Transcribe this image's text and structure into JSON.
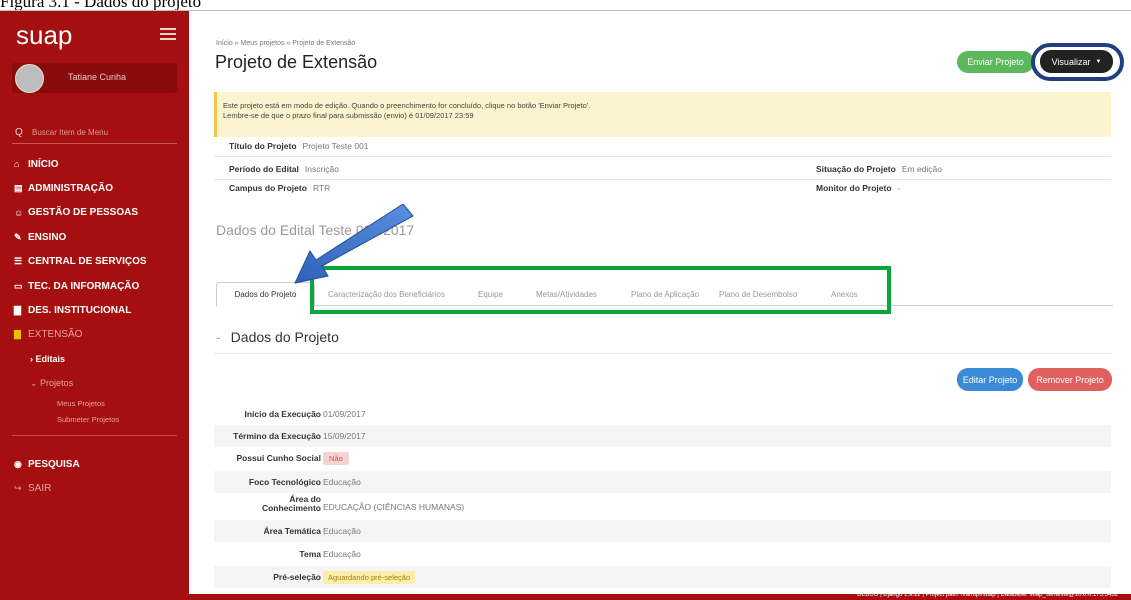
{
  "caption": "Figura 3.1 - Dados do projeto",
  "sidebar": {
    "brand": "suap",
    "user_name": "Tatiane Cunha",
    "search_placeholder": "Buscar Item de Menu",
    "menu": [
      {
        "icon": "home-icon",
        "glyph": "⌂",
        "label": "INÍCIO"
      },
      {
        "icon": "admin-icon",
        "glyph": "▤",
        "label": "ADMINISTRAÇÃO"
      },
      {
        "icon": "people-icon",
        "glyph": "☺",
        "label": "GESTÃO DE PESSOAS"
      },
      {
        "icon": "pencil-icon",
        "glyph": "✎",
        "label": "ENSINO"
      },
      {
        "icon": "list-icon",
        "glyph": "☰",
        "label": "CENTRAL DE SERVIÇOS"
      },
      {
        "icon": "monitor-icon",
        "glyph": "▭",
        "label": "TEC. DA INFORMAÇÃO"
      },
      {
        "icon": "chart-icon",
        "glyph": "▇",
        "label": "DES. INSTITUCIONAL"
      },
      {
        "icon": "extension-icon",
        "glyph": "▇",
        "label": "EXTENSÃO"
      }
    ],
    "sub_editais": "Editais",
    "sub_projetos": "Projetos",
    "sub_meus": "Meus Projetos",
    "sub_submeter": "Submeter Projetos",
    "pesquisa": "PESQUISA",
    "sair": "SAIR"
  },
  "header": {
    "breadcrumb": "Início » Meus projetos » Projeto de Extensão",
    "title": "Projeto de Extensão",
    "send_button": "Enviar Projeto",
    "view_button": "Visualizar"
  },
  "notice": {
    "line1": "Este projeto está em modo de edição. Quando o preenchimento for concluído, clique no botão 'Enviar Projeto'.",
    "line2": "Lembre-se de que o prazo final para submissão (envio) é 01/09/2017 23:59"
  },
  "info": {
    "titulo_label": "Título do Projeto",
    "titulo_value": "Projeto Teste 001",
    "periodo_label": "Período do Edital",
    "periodo_value": "Inscrição",
    "campus_label": "Campus do Projeto",
    "campus_value": "RTR",
    "situacao_label": "Situação do Projeto",
    "situacao_value": "Em edição",
    "monitor_label": "Monitor do Projeto",
    "monitor_value": "-"
  },
  "edital_title": "Dados do Edital Teste 001/2017",
  "tabs": [
    "Dados do Projeto",
    "Caracterização dos Beneficiários",
    "Equipe",
    "Metas/Atividades",
    "Plano de Aplicação",
    "Plano de Desembolso",
    "Anexos"
  ],
  "section": {
    "dash": "-",
    "title": "Dados do Projeto",
    "edit_button": "Editar Projeto",
    "remove_button": "Remover Projeto"
  },
  "details": [
    {
      "label": "Início da Execução",
      "value": "01/09/2017"
    },
    {
      "label": "Término da Execução",
      "value": "15/09/2017"
    },
    {
      "label": "Possui Cunho Social",
      "value": "Não"
    },
    {
      "label": "Foco Tecnológico",
      "value": "Educação"
    },
    {
      "label1": "Área do",
      "label2": "Conhecimento",
      "value": "EDUCAÇÃO (CIÊNCIAS HUMANAS)"
    },
    {
      "label": "Área Temática",
      "value": "Educação"
    },
    {
      "label": "Tema",
      "value": "Educação"
    },
    {
      "label": "Pré-seleção",
      "value": "Aguardando pré-seleção"
    }
  ],
  "footer": "DEBUG | Django 1.9.12 | Project path: /var/opt/suap | Database: suap_senteste@10.0.0.175:5432",
  "colors": {
    "sidebar": "#a50f0f",
    "send": "#5cb85c",
    "view": "#222222",
    "edit": "#3b8ad8",
    "remove": "#e06060",
    "annotation_green": "#0aa53c",
    "annotation_blue": "#1f3f80"
  }
}
